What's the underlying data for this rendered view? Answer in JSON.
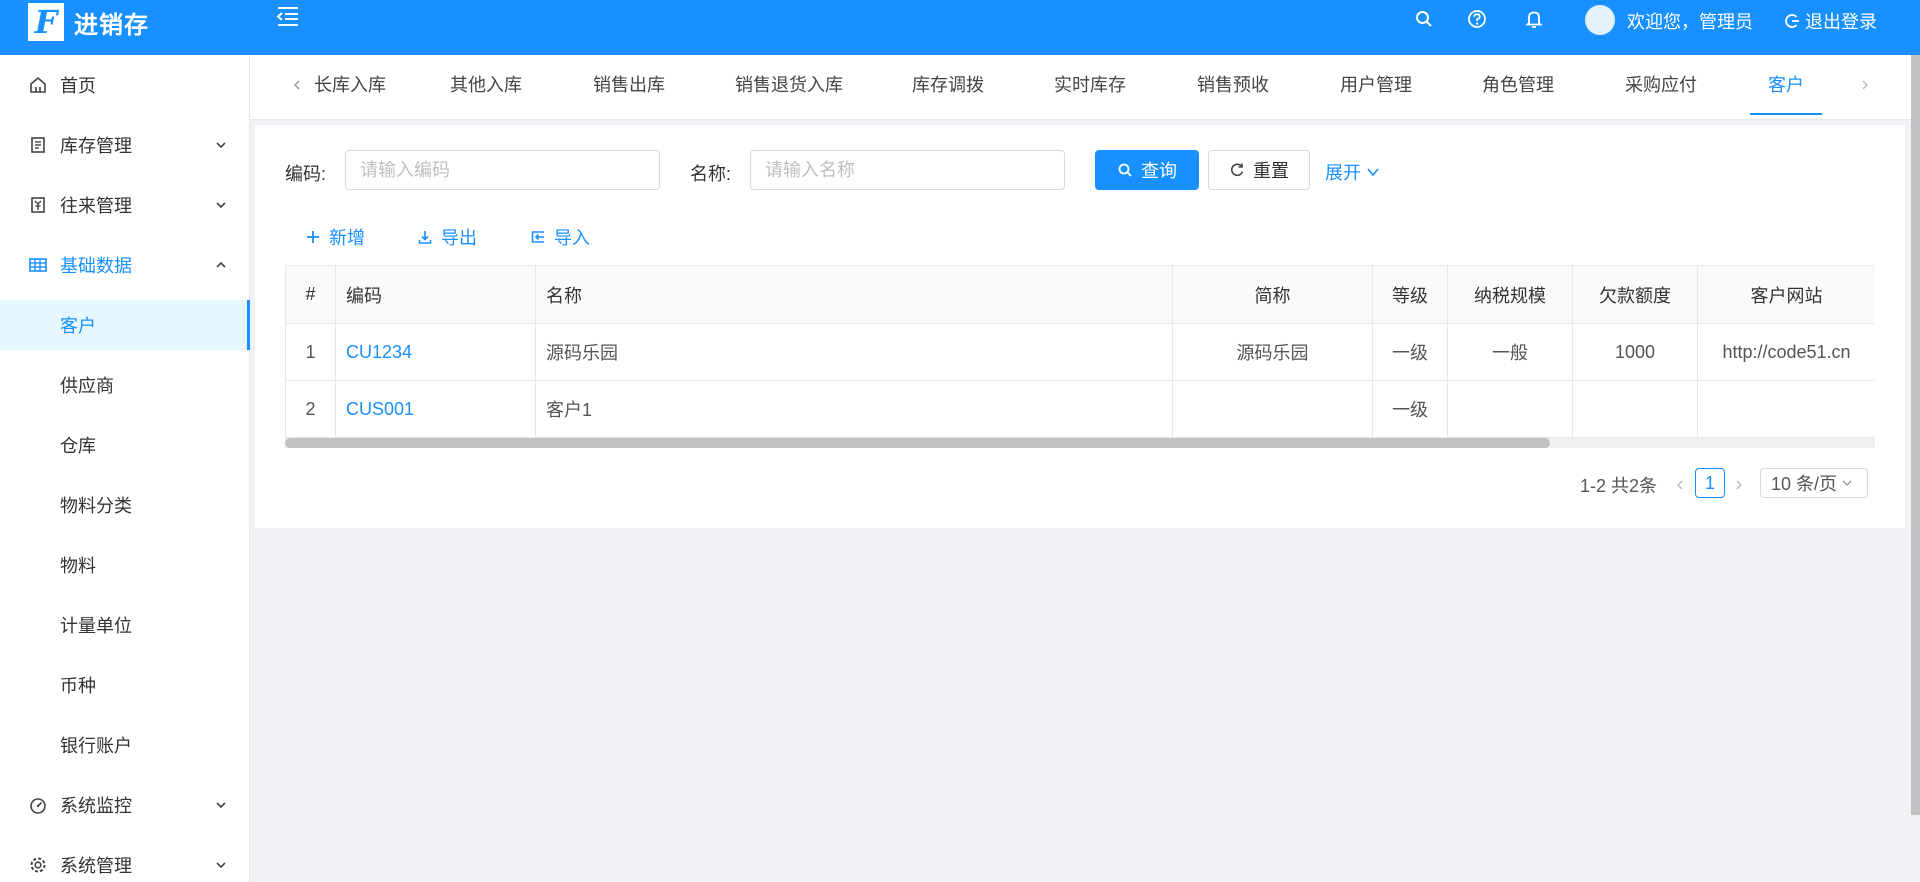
{
  "header": {
    "logo_letter": "F",
    "app_name": "进销存",
    "welcome": "欢迎您，管理员",
    "logout": "退出登录",
    "brand_color": "#1890ff"
  },
  "sidebar": {
    "items": [
      {
        "label": "首页",
        "icon": "home-icon"
      },
      {
        "label": "库存管理",
        "icon": "inventory-icon"
      },
      {
        "label": "往来管理",
        "icon": "money-icon"
      },
      {
        "label": "基础数据",
        "icon": "table-icon"
      },
      {
        "label": "客户"
      },
      {
        "label": "供应商"
      },
      {
        "label": "仓库"
      },
      {
        "label": "物料分类"
      },
      {
        "label": "物料"
      },
      {
        "label": "计量单位"
      },
      {
        "label": "币种"
      },
      {
        "label": "银行账户"
      },
      {
        "label": "系统监控",
        "icon": "dashboard-icon"
      },
      {
        "label": "系统管理",
        "icon": "gear-icon"
      }
    ]
  },
  "tabs": [
    "长库入库",
    "其他入库",
    "销售出库",
    "销售退货入库",
    "库存调拨",
    "实时库存",
    "销售预收",
    "用户管理",
    "角色管理",
    "采购应付",
    "客户"
  ],
  "search": {
    "code_label": "编码:",
    "code_placeholder": "请输入编码",
    "name_label": "名称:",
    "name_placeholder": "请输入名称",
    "query": "查询",
    "reset": "重置",
    "expand": "展开"
  },
  "toolbar": {
    "add": "新增",
    "export": "导出",
    "import": "导入"
  },
  "table": {
    "columns": [
      "#",
      "编码",
      "名称",
      "简称",
      "等级",
      "纳税规模",
      "欠款额度",
      "客户网站"
    ],
    "rows": [
      {
        "index": "1",
        "code": "CU1234",
        "name": "源码乐园",
        "short": "源码乐园",
        "level": "一级",
        "tax": "一般",
        "credit": "1000",
        "website": "http://code51.cn"
      },
      {
        "index": "2",
        "code": "CUS001",
        "name": "客户1",
        "short": "",
        "level": "一级",
        "tax": "",
        "credit": "",
        "website": ""
      }
    ]
  },
  "pagination": {
    "total": "1-2 共2条",
    "current": "1",
    "page_size": "10 条/页"
  }
}
